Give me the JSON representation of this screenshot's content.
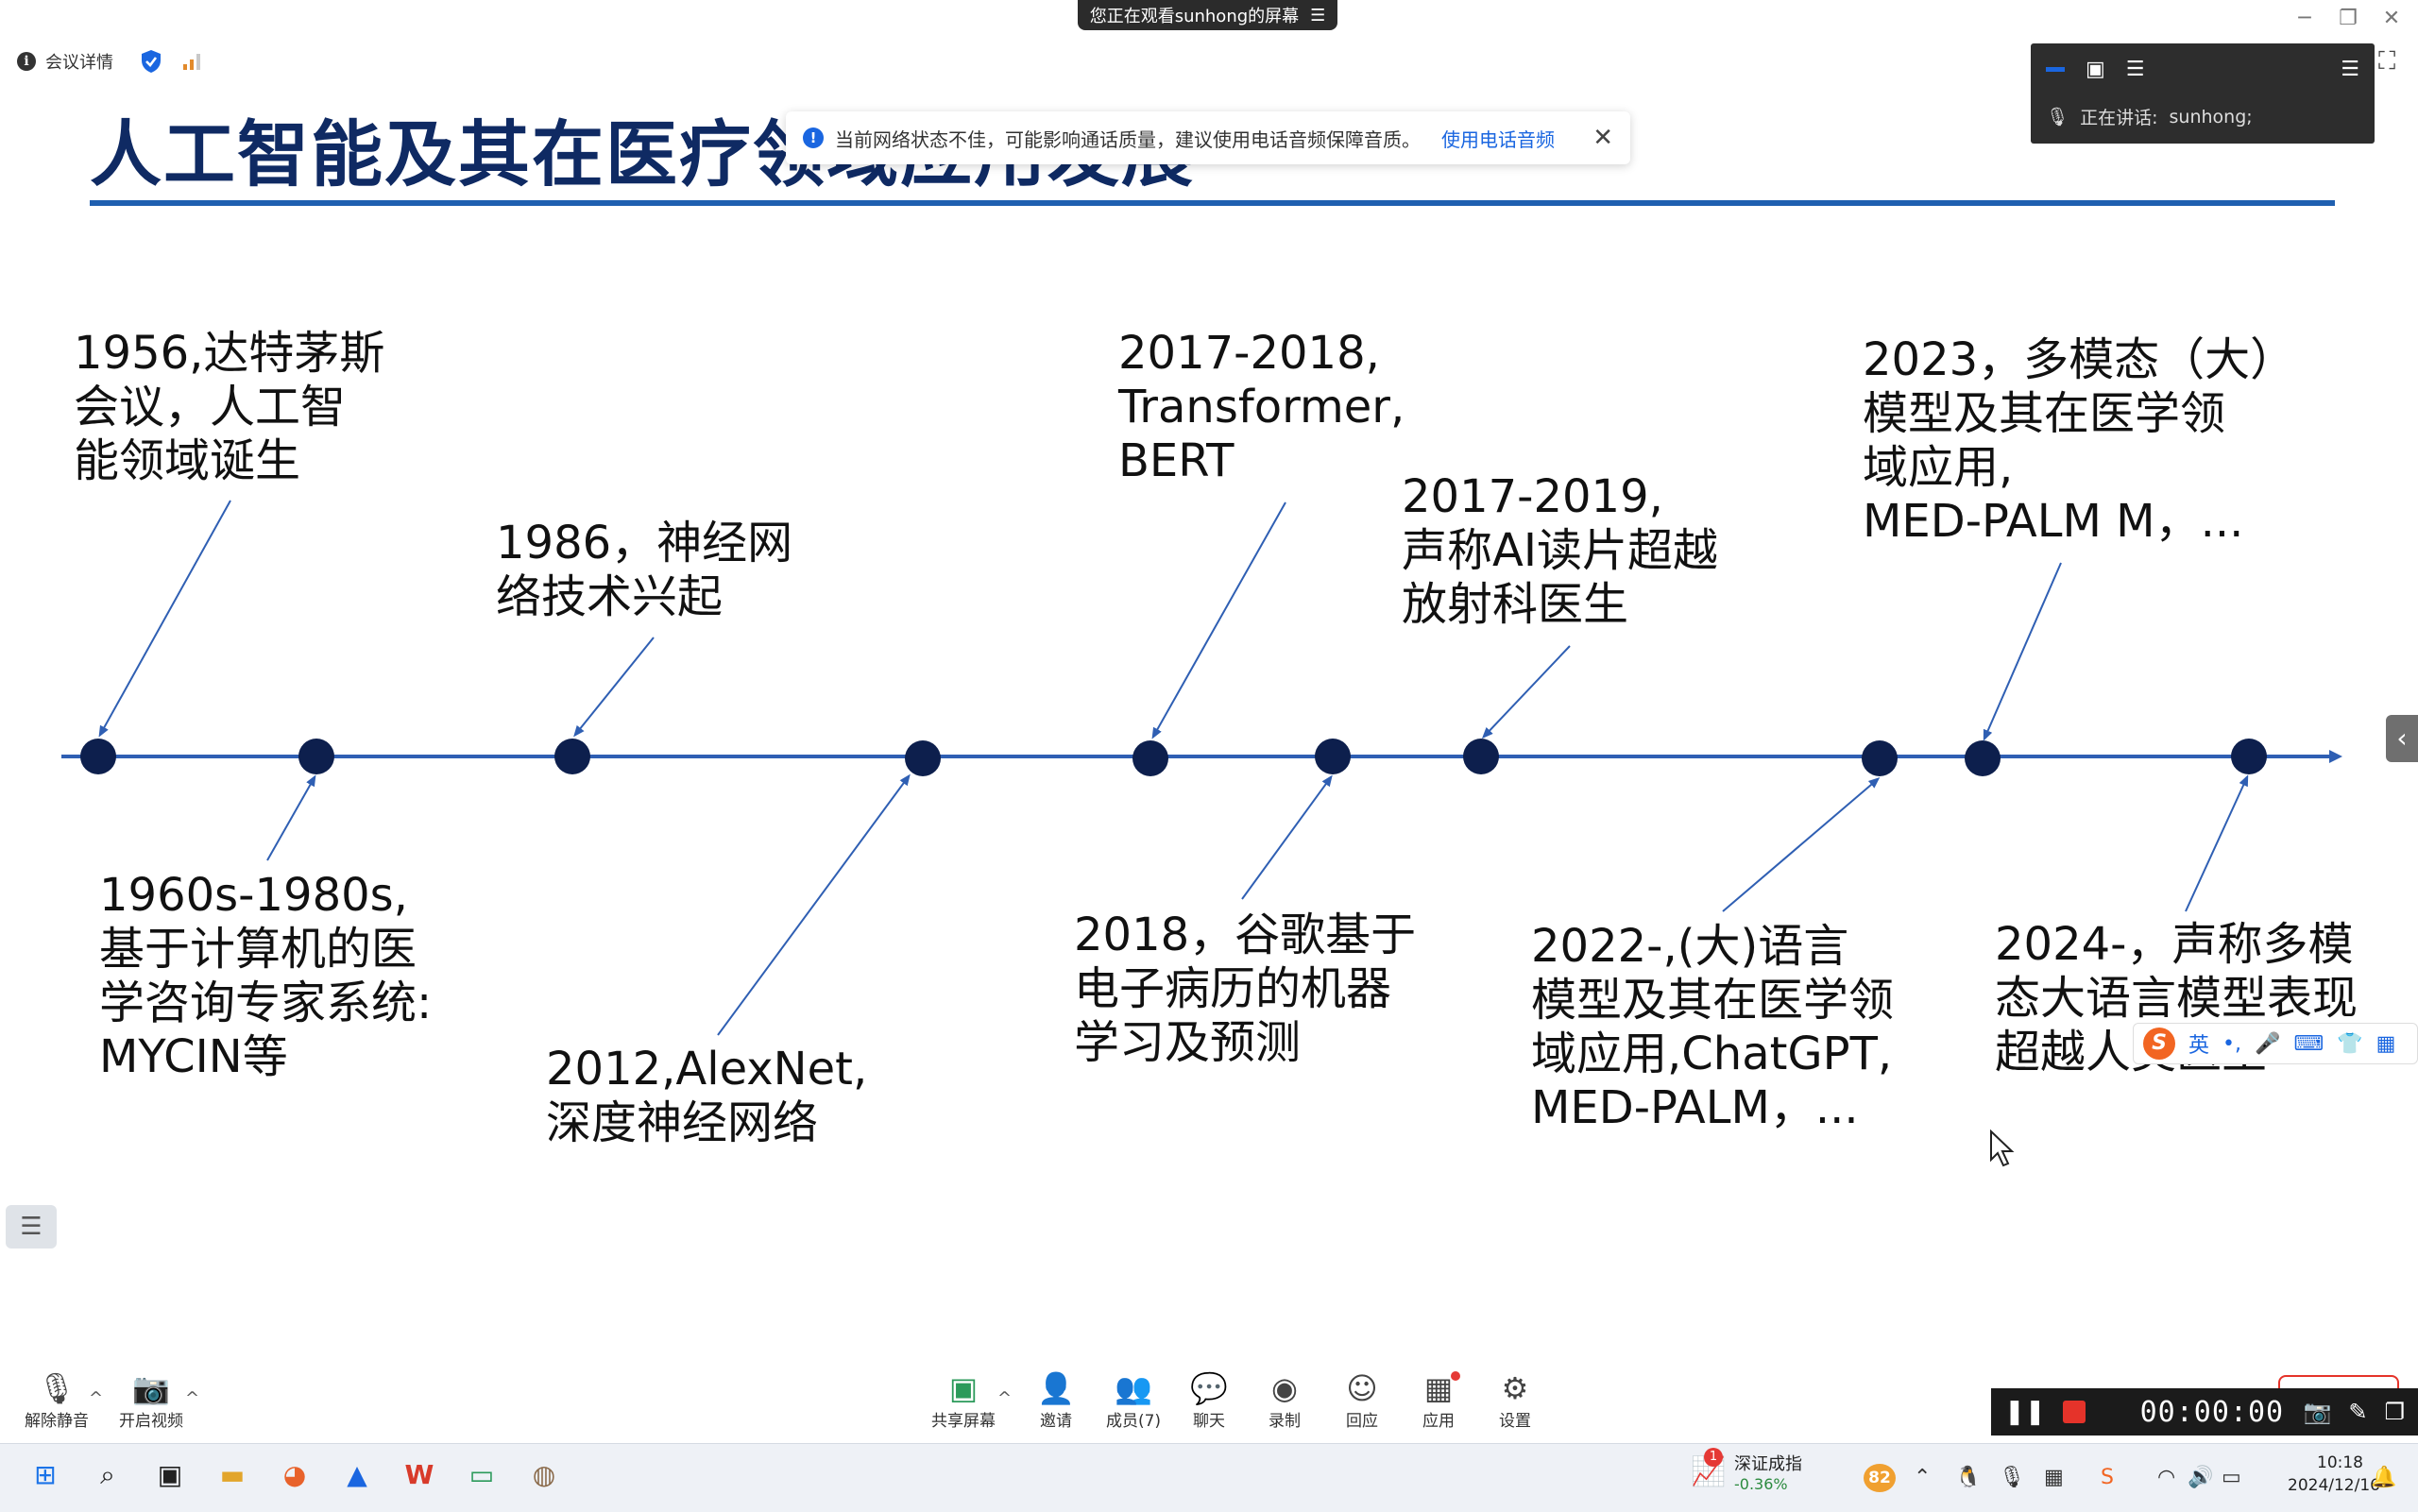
{
  "share_banner": {
    "text": "您正在观看sunhong的屏幕",
    "menu_icon": "menu-icon"
  },
  "meeting_bar": {
    "info_label": "会议详情"
  },
  "slide": {
    "title": "人工智能及其在医疗领域应用发展",
    "timeline_above": [
      {
        "text": "1956,达特茅斯\n会议，人工智\n能领域诞生"
      },
      {
        "text": "1986，神经网\n络技术兴起"
      },
      {
        "text": "2017-2018,\nTransformer,\nBERT"
      },
      {
        "text": "2017-2019,\n声称AI读片超越\n放射科医生"
      },
      {
        "text": "2023，多模态（大）\n模型及其在医学领\n域应用,\nMED-PALM M，..."
      }
    ],
    "timeline_below": [
      {
        "text": "1960s-1980s,\n基于计算机的医\n学咨询专家系统:\nMYCIN等"
      },
      {
        "text": "2012,AlexNet,\n深度神经网络"
      },
      {
        "text": "2018，谷歌基于\n电子病历的机器\n学习及预测"
      },
      {
        "text": "2022-,(大)语言\n模型及其在医学领\n域应用,ChatGPT,\nMED-PALM，..."
      },
      {
        "text": "2024-，声称多模\n态大语言模型表现\n超越人类医生"
      }
    ]
  },
  "notice": {
    "text": "当前网络状态不佳，可能影响通话质量，建议使用电话音频保障音质。",
    "link": "使用电话音频"
  },
  "speaker_panel": {
    "speaking_label": "正在讲话:",
    "speaker": "sunhong;"
  },
  "ime": {
    "lang": "英"
  },
  "toolbar": {
    "unmute": "解除静音",
    "start_video": "开启视频",
    "share_screen": "共享屏幕",
    "invite": "邀请",
    "members": "成员(7)",
    "chat": "聊天",
    "record": "录制",
    "reply": "回应",
    "apps": "应用",
    "settings": "设置"
  },
  "recording": {
    "time": "00:00:00"
  },
  "taskbar": {
    "stock_name": "深证成指",
    "stock_change": "-0.36%",
    "stock_badge": "1",
    "app_badge": "82",
    "time": "10:18",
    "date": "2024/12/16"
  },
  "colors": {
    "title": "#0f2a63",
    "timeline": "#2f5fb3",
    "dot": "#0d1f4d",
    "accent": "#1a66e0"
  }
}
